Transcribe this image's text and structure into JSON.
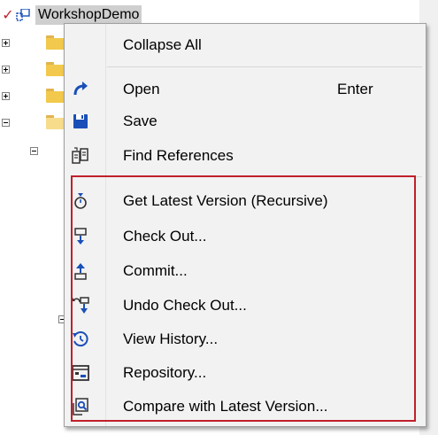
{
  "tree": {
    "root_label": "WorkshopDemo",
    "root_check": "✓"
  },
  "menu": {
    "items": [
      {
        "label": "Collapse All",
        "icon": "none"
      },
      {
        "label": "Open",
        "shortcut": "Enter",
        "icon": "open-arrow-icon"
      },
      {
        "label": "Save",
        "icon": "save-disk-icon"
      },
      {
        "label": "Find References",
        "icon": "find-references-icon"
      },
      {
        "label": "Get Latest Version (Recursive)",
        "icon": "get-latest-icon"
      },
      {
        "label": "Check Out...",
        "icon": "check-out-icon"
      },
      {
        "label": "Commit...",
        "icon": "commit-icon"
      },
      {
        "label": "Undo Check Out...",
        "icon": "undo-check-out-icon"
      },
      {
        "label": "View History...",
        "icon": "history-icon"
      },
      {
        "label": "Repository...",
        "icon": "repository-icon"
      },
      {
        "label": "Compare with Latest Version...",
        "icon": "compare-icon"
      }
    ]
  },
  "colors": {
    "accent_blue": "#1a4fb8",
    "highlight_red": "#c0202a",
    "menu_bg": "#f2f2f2"
  }
}
